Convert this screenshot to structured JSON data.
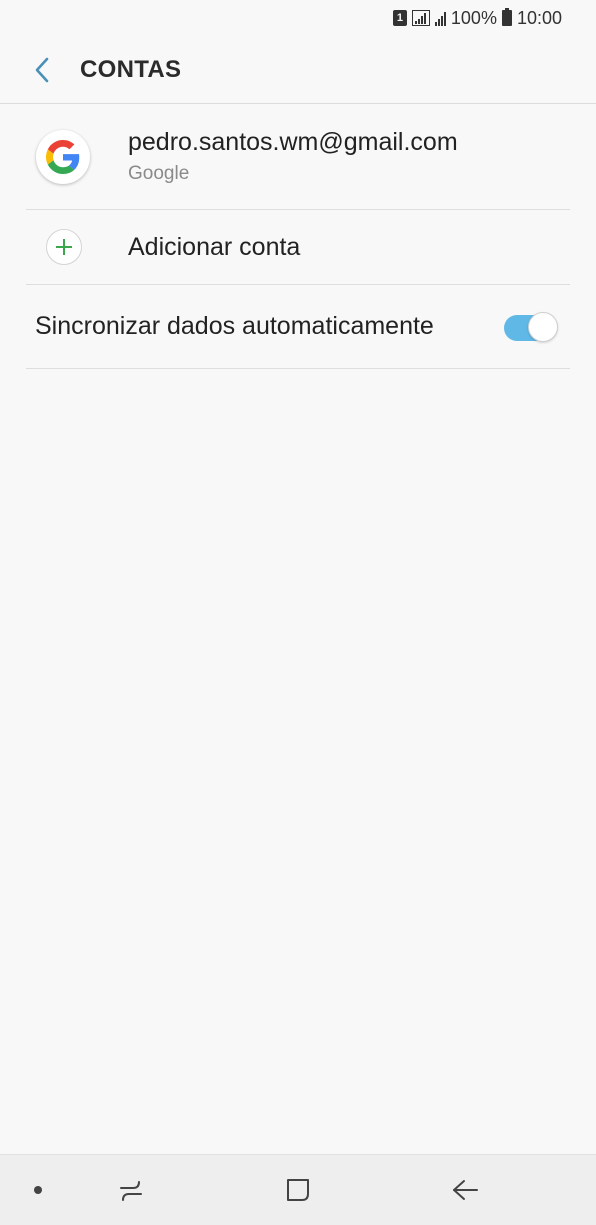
{
  "status_bar": {
    "sim_label": "1",
    "battery_text": "100%",
    "time": "10:00",
    "icons": [
      "sim-icon",
      "signal-icon",
      "signal-icon",
      "battery-icon"
    ]
  },
  "app_bar": {
    "title": "CONTAS",
    "back_icon": "chevron-left-icon",
    "accent_color": "#4a90b8"
  },
  "accounts": [
    {
      "email": "pedro.santos.wm@gmail.com",
      "type": "Google",
      "icon": "google-icon"
    }
  ],
  "add_account": {
    "label": "Adicionar conta",
    "icon": "plus-icon",
    "icon_color": "#3aa84a"
  },
  "sync": {
    "label": "Sincronizar dados automaticamente",
    "enabled": true,
    "toggle_color": "#5fb8e6"
  },
  "nav_bar": {
    "items": [
      "dot-icon",
      "recents-icon",
      "home-icon",
      "back-arrow-icon"
    ]
  }
}
